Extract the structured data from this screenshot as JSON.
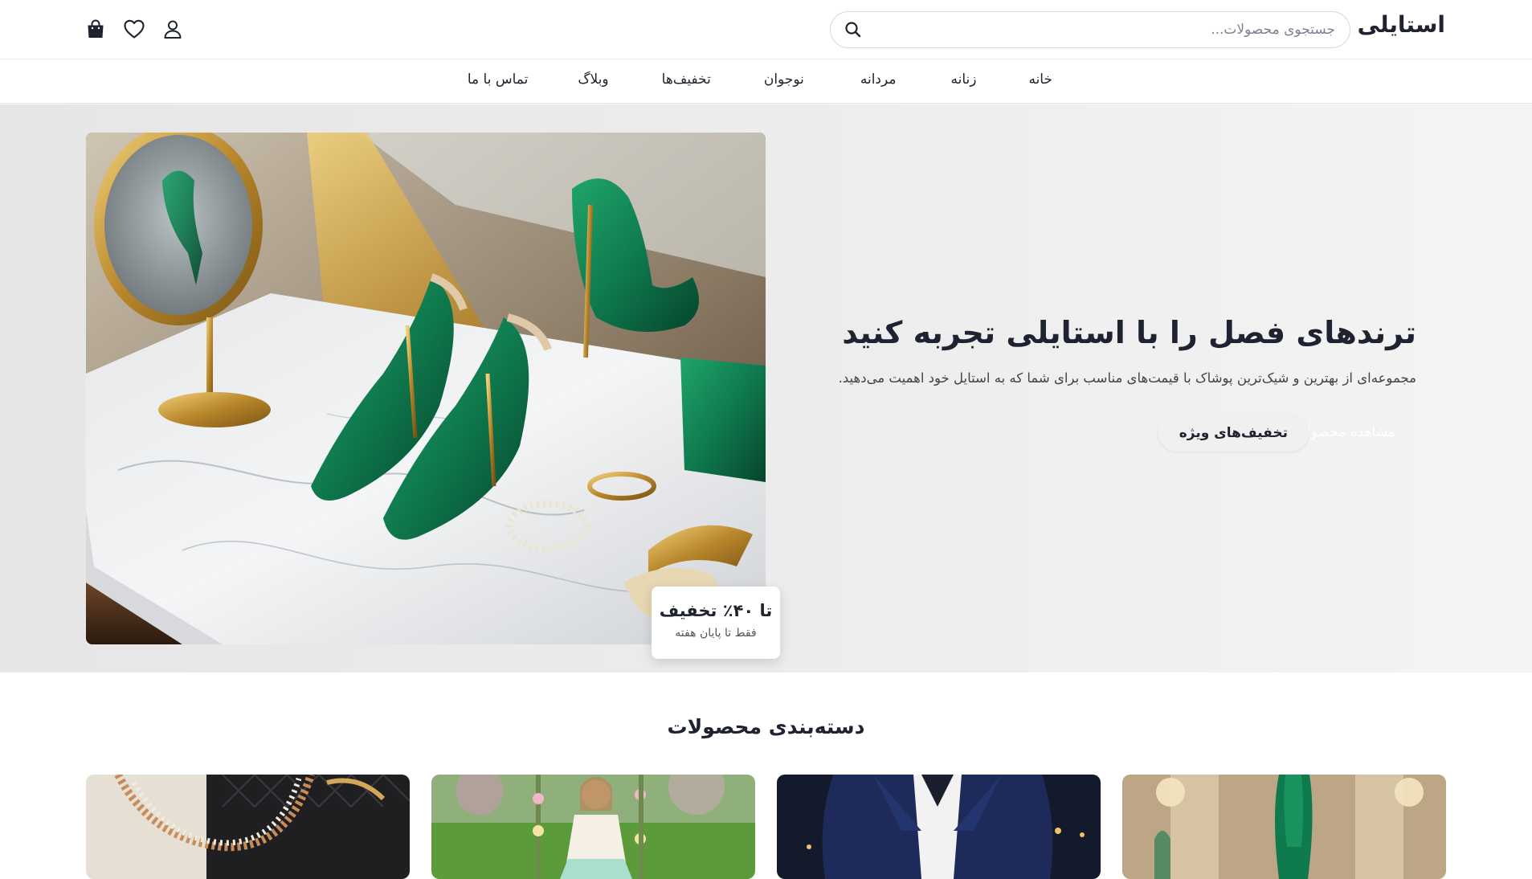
{
  "header": {
    "logo": "استایلی",
    "search_placeholder": "جستجوی محصولات...",
    "icons": [
      "search-icon",
      "user-icon",
      "heart-icon",
      "shopping-bag-icon"
    ]
  },
  "nav": {
    "items": [
      {
        "label": "خانه"
      },
      {
        "label": "زنانه"
      },
      {
        "label": "مردانه"
      },
      {
        "label": "نوجوان"
      },
      {
        "label": "تخفیف‌ها"
      },
      {
        "label": "وبلاگ"
      },
      {
        "label": "تماس با ما"
      }
    ]
  },
  "hero": {
    "title": "ترندهای فصل را با استایلی تجربه کنید",
    "subtitle": "مجموعه‌ای از بهترین و شیک‌ترین پوشاک با قیمت‌های مناسب برای شما که به استایل خود اهمیت می‌دهید.",
    "primary_button": "مشاهده محصولات",
    "secondary_button": "تخفیف‌های ویژه",
    "badge_title": "تا ۴۰٪ تخفیف",
    "badge_subtitle": "فقط تا پایان هفته"
  },
  "categories": {
    "title": "دسته‌بندی محصولات"
  },
  "colors": {
    "text": "#1f2230",
    "accent_green": "#0f7a4e",
    "hero_bg": "#ebebeb"
  }
}
